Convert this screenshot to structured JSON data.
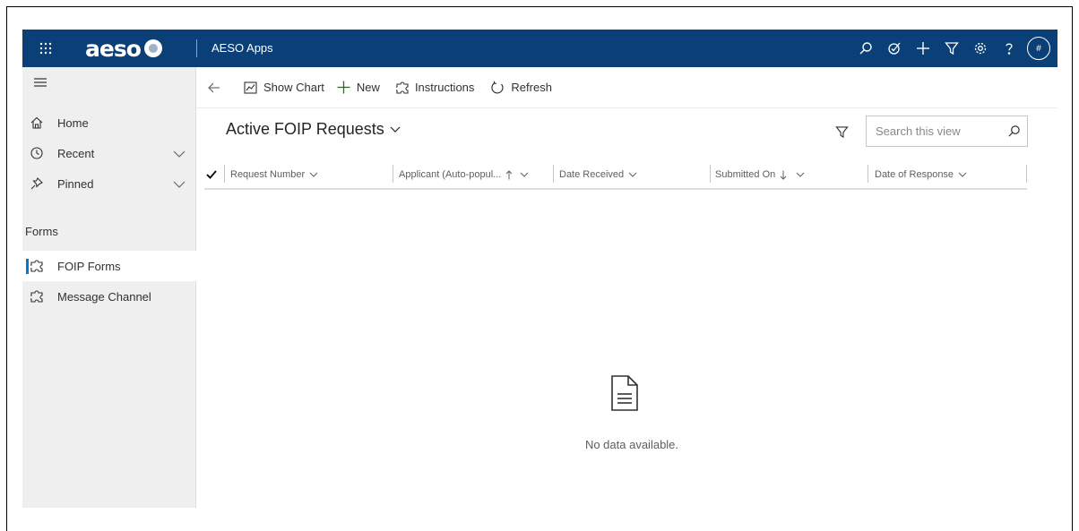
{
  "topbar": {
    "brand": "aeso",
    "app_title": "AESO Apps",
    "avatar_text": "#"
  },
  "sidebar": {
    "items": [
      {
        "label": "Home"
      },
      {
        "label": "Recent"
      },
      {
        "label": "Pinned"
      }
    ],
    "section_title": "Forms",
    "forms": [
      {
        "label": "FOIP Forms"
      },
      {
        "label": "Message Channel"
      }
    ]
  },
  "commandbar": {
    "show_chart": "Show Chart",
    "new": "New",
    "instructions": "Instructions",
    "refresh": "Refresh"
  },
  "view": {
    "title": "Active FOIP Requests",
    "search_placeholder": "Search this view"
  },
  "grid": {
    "columns": [
      {
        "label": "Request Number"
      },
      {
        "label": "Applicant (Auto-popul..."
      },
      {
        "label": "Date Received"
      },
      {
        "label": "Submitted On"
      },
      {
        "label": "Date of Response"
      }
    ],
    "empty_text": "No data available."
  },
  "colors": {
    "topbar_bg": "#0b3f78",
    "accent": "#0078d4",
    "new_icon": "#107c10"
  }
}
